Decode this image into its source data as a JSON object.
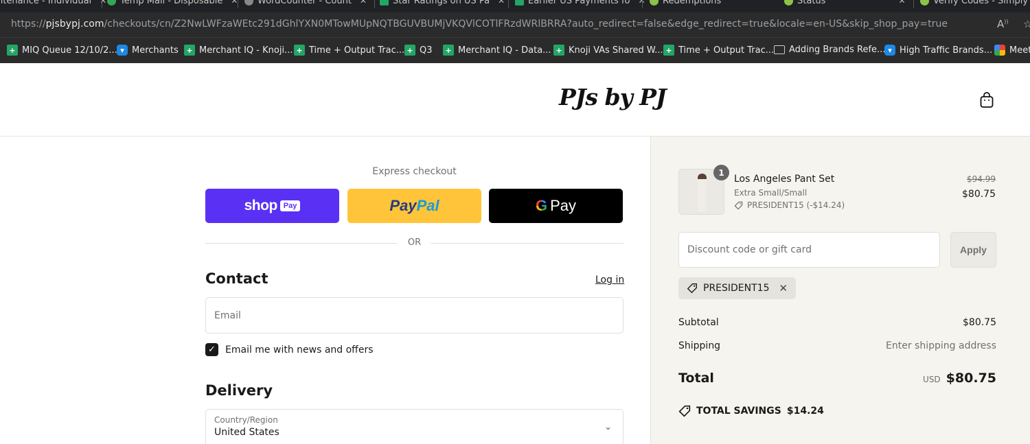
{
  "browser": {
    "tabs": [
      {
        "title": "ntenance - Individual",
        "icon_color": "#888888"
      },
      {
        "title": "Temp Mail - Disposable",
        "icon_color": "#34a853"
      },
      {
        "title": "WordCounter - Count",
        "icon_color": "#888888"
      },
      {
        "title": "Star Ratings on US Pa",
        "icon_color": "#23a566"
      },
      {
        "title": "Earlier US Payments fo",
        "icon_color": "#23a566"
      },
      {
        "title": "Redemptions",
        "icon_color": "#8bc34a"
      },
      {
        "title": "Status",
        "icon_color": "#8bc34a"
      },
      {
        "title": "Verify Codes - Simply",
        "icon_color": "#8bc34a"
      }
    ],
    "url": {
      "scheme": "https://",
      "host": "pjsbypj.com",
      "path": "/checkouts/cn/Z2NwLWFzaWEtc291dGhlYXN0MTowMUpNQTBGUVBUMjVKQVlCOTlFRzdWRlBRRA?auto_redirect=false&edge_redirect=true&locale=en-US&skip_shop_pay=true"
    },
    "bookmarks": [
      {
        "label": "MIQ Queue 12/10/2...",
        "icon": "sheets-icon"
      },
      {
        "label": "Merchants",
        "icon": "chat-icon"
      },
      {
        "label": "Merchant IQ - Knoji...",
        "icon": "sheets-icon"
      },
      {
        "label": "Time + Output Trac...",
        "icon": "sheets-icon"
      },
      {
        "label": "Q3",
        "icon": "sheets-icon"
      },
      {
        "label": "Merchant IQ - Data...",
        "icon": "sheets-icon"
      },
      {
        "label": "Knoji VAs Shared W...",
        "icon": "sheets-icon"
      },
      {
        "label": "Time + Output Trac...",
        "icon": "sheets-icon"
      },
      {
        "label": "Adding Brands Refe...",
        "icon": "folder-icon"
      },
      {
        "label": "High Traffic Brands...",
        "icon": "chat-icon"
      },
      {
        "label": "Meet",
        "icon": "meet-icon"
      }
    ]
  },
  "store": {
    "logo": "PJs by PJ"
  },
  "checkout": {
    "express_label": "Express checkout",
    "shop_pay": {
      "word": "shop",
      "pay": "Pay"
    },
    "paypal": {
      "part1": "Pay",
      "part2": "Pal"
    },
    "gpay": {
      "g": "G",
      "pay": "Pay"
    },
    "or_label": "OR",
    "contact_title": "Contact",
    "login_label": "Log in",
    "email_placeholder": "Email",
    "newsletter_label": "Email me with news and offers",
    "newsletter_checked": true,
    "delivery_title": "Delivery",
    "country_label": "Country/Region",
    "country_value": "United States"
  },
  "summary": {
    "item": {
      "qty": "1",
      "name": "Los Angeles Pant Set",
      "variant": "Extra Small/Small",
      "discount": "PRESIDENT15 (-$14.24)",
      "price_original": "$94.99",
      "price": "$80.75"
    },
    "discount_placeholder": "Discount code or gift card",
    "apply_label": "Apply",
    "applied_code": "PRESIDENT15",
    "subtotal_label": "Subtotal",
    "subtotal_value": "$80.75",
    "shipping_label": "Shipping",
    "shipping_value": "Enter shipping address",
    "total_label": "Total",
    "currency": "USD",
    "total_value": "$80.75",
    "savings_label": "TOTAL SAVINGS",
    "savings_value": "$14.24"
  },
  "colors": {
    "shop_pay": "#5a31f4",
    "paypal": "#ffc439",
    "summary_bg": "#f5f4ef"
  }
}
